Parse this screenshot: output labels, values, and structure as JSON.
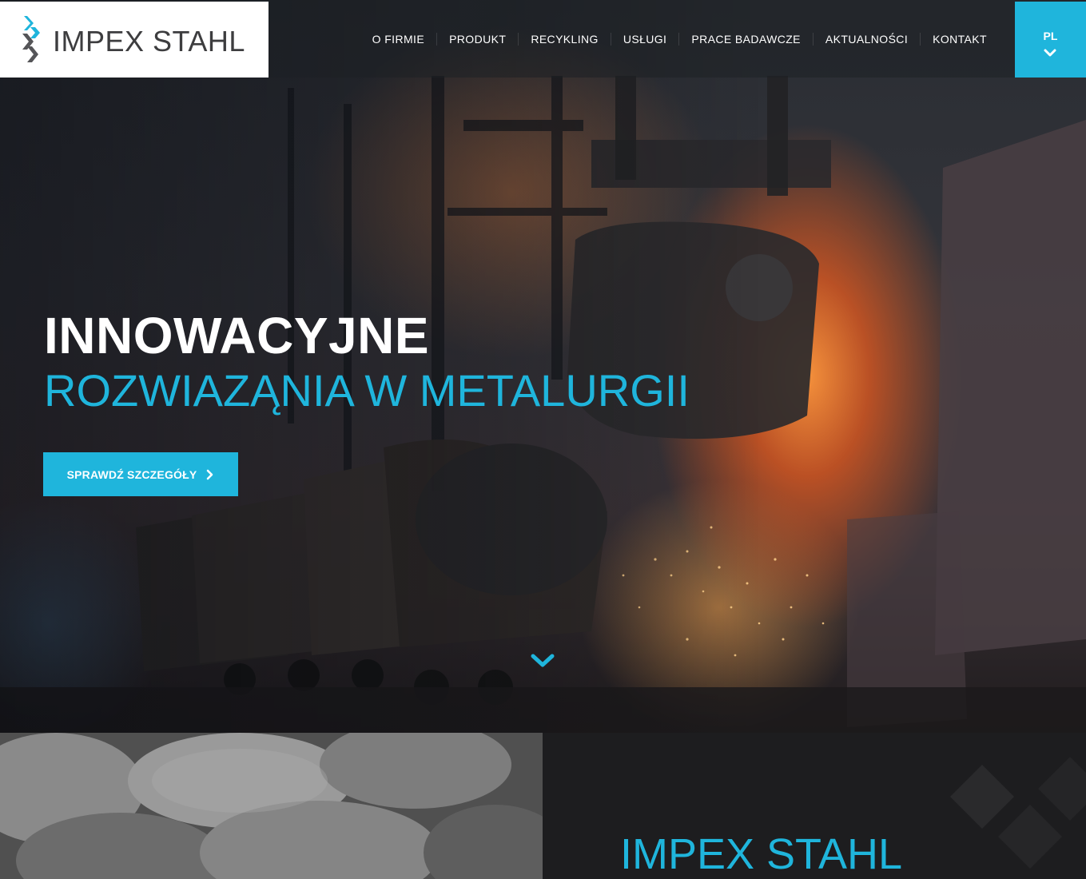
{
  "brand": {
    "name": "IMPEX STAHL"
  },
  "nav": {
    "items": [
      {
        "label": "O FIRMIE"
      },
      {
        "label": "PRODUKT"
      },
      {
        "label": "RECYKLING"
      },
      {
        "label": "USŁUGI"
      },
      {
        "label": "PRACE BADAWCZE"
      },
      {
        "label": "AKTUALNOŚCI"
      },
      {
        "label": "KONTAKT"
      }
    ],
    "language": "PL"
  },
  "hero": {
    "title": "INNOWACYJNE",
    "subtitle": "ROZWIAZĄNIA W METALURGII",
    "cta_label": "SPRAWDŹ SZCZEGÓŁY"
  },
  "section": {
    "title": "IMPEX STAHL"
  },
  "colors": {
    "accent": "#1fb5dc",
    "logo_text": "#3d3d3f",
    "dark_panel": "#1d1d1f"
  },
  "icons": {
    "logo": "impex-stahl-logo-mark",
    "language_toggle": "chevron-down-icon",
    "cta": "chevron-right-icon",
    "scroll": "chevron-down-icon"
  }
}
